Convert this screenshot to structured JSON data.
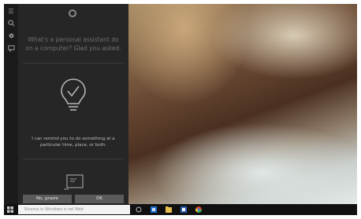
{
  "cortana": {
    "headline": "What's a personal assistant do on a computer? Glad you asked.",
    "reminder_text": "I can remind you to do something at a particular time, place, or both.",
    "no_thanks_label": "No, grazie",
    "ok_label": "OK"
  },
  "taskbar": {
    "search_placeholder": "Ricerca in Windows e nel Web",
    "pinned_icons": [
      "task-view-icon",
      "store-icon",
      "file-explorer-icon",
      "word-icon",
      "chrome-icon"
    ]
  },
  "rail": {
    "icons": [
      "hamburger-menu-icon",
      "search-icon",
      "settings-icon",
      "feedback-icon"
    ]
  },
  "colors": {
    "panel": "#262626",
    "taskbar": "#101010",
    "button": "#5a5a5a",
    "store_blue": "#1e6fd0",
    "explorer_yellow": "#e8c050"
  }
}
